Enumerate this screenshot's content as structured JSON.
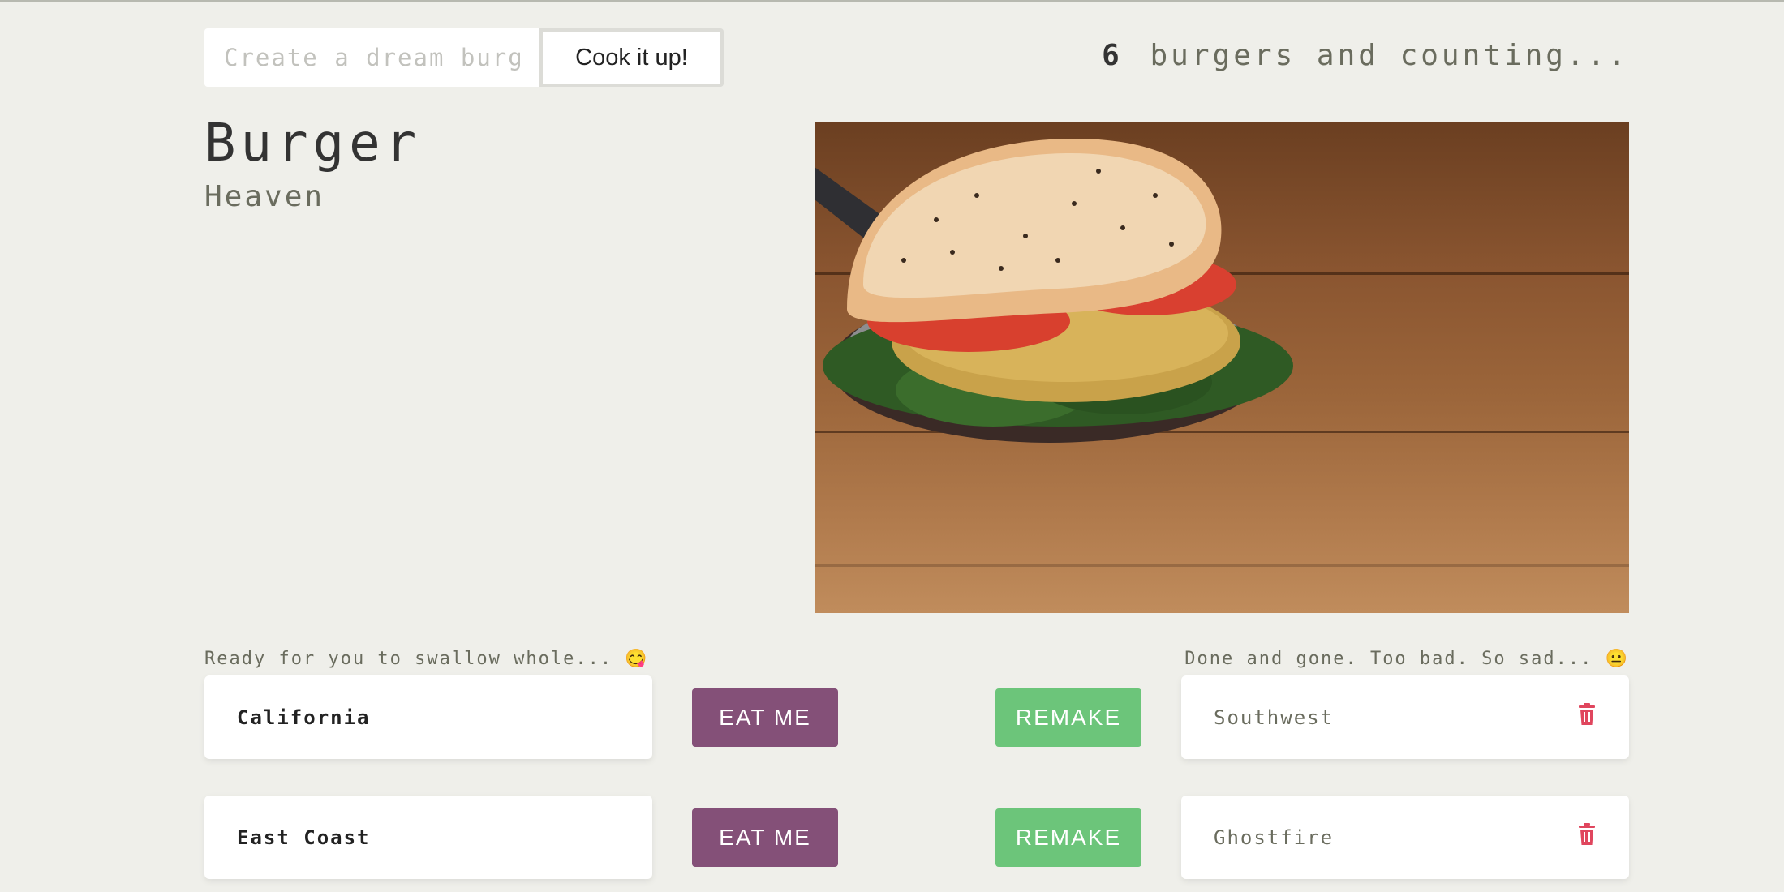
{
  "create": {
    "placeholder": "Create a dream burger",
    "button_label": "Cook it up!"
  },
  "counter": {
    "count": "6",
    "label": "burgers and counting..."
  },
  "title": "Burger",
  "subtitle": "Heaven",
  "ready_list": {
    "caption": "Ready for you to swallow whole... 😋",
    "action_label": "EAT ME",
    "items": [
      {
        "name": "California"
      },
      {
        "name": "East Coast"
      }
    ]
  },
  "eaten_list": {
    "caption": "Done and gone. Too bad. So sad... 😐",
    "action_label": "REMAKE",
    "items": [
      {
        "name": "Southwest"
      },
      {
        "name": "Ghostfire"
      }
    ]
  },
  "colors": {
    "eat_button": "#845078",
    "remake_button": "#6cc57a",
    "trash_icon": "#e0465e",
    "background": "#efefea"
  }
}
